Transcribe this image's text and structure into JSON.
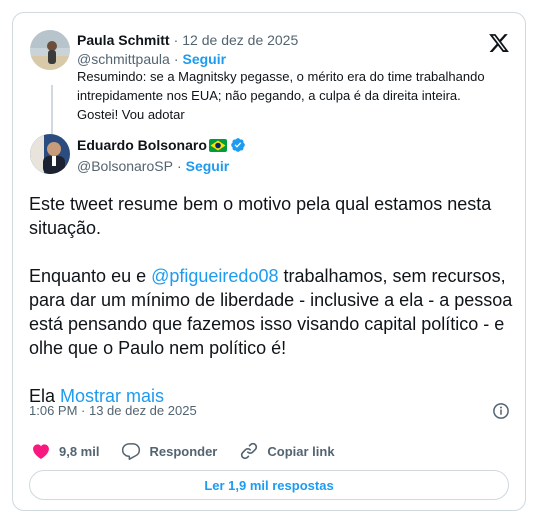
{
  "quoted": {
    "name": "Paula Schmitt",
    "date": "12 de dez de 2025",
    "handle": "@schmittpaula",
    "follow_label": "Seguir",
    "text": "Resumindo: se a Magnitsky pegasse, o mérito era do time trabalhando intrepidamente nos EUA; não pegando, a culpa é da direita inteira. Gostei! Vou adotar"
  },
  "tweet": {
    "name": "Eduardo Bolsonaro",
    "handle": "@BolsonaroSP",
    "follow_label": "Seguir",
    "paragraph1": "Este tweet resume bem o motivo pela qual estamos nesta situação.",
    "paragraph2_before": "Enquanto eu e ",
    "paragraph2_mention": "@pfigueiredo08",
    "paragraph2_after": " trabalhamos, sem recursos, para dar um mínimo de liberdade - inclusive a ela - a pessoa está pensando que fazemos isso visando capital político - e olhe que o Paulo nem político é!",
    "paragraph3_prefix": "Ela",
    "show_more_label": "Mostrar mais",
    "timestamp": "1:06 PM · 13 de dez de 2025"
  },
  "actions": {
    "likes": "9,8 mil",
    "reply_label": "Responder",
    "copy_link_label": "Copiar link"
  },
  "replies_button_label": "Ler 1,9 mil respostas",
  "colors": {
    "accent": "#1d9bf0",
    "like": "#f91880",
    "border": "#cfd9de",
    "muted": "#536471"
  },
  "icons": [
    "x-logo-icon",
    "brazil-flag-icon",
    "verified-badge-icon",
    "info-icon",
    "heart-icon",
    "reply-icon",
    "link-icon"
  ]
}
